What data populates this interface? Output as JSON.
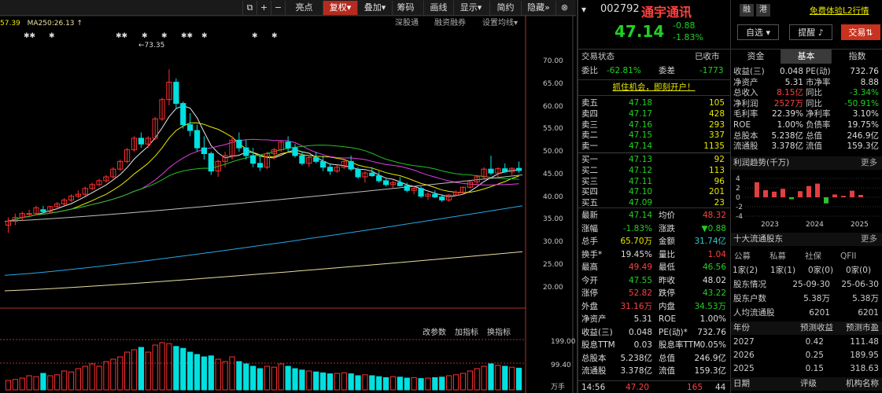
{
  "toolbar": {
    "items": [
      "亮点",
      "复权",
      "叠加",
      "筹码",
      "画线",
      "显示",
      "简约",
      "隐藏"
    ],
    "icons": [
      "layout-icon",
      "plus-icon",
      "minus-icon",
      "more-icon",
      "collapse-icon"
    ],
    "active": "复权"
  },
  "chart": {
    "ma_text1": "57.39",
    "ma_label2": "MA250:26.13",
    "ma_arrow": "↑",
    "stars": [
      "✱✱",
      "✱",
      "✱✱",
      "✱",
      "✱",
      "✱✱",
      "✱",
      "✱",
      "✱"
    ],
    "right_tools": [
      "深股通",
      "融资融券",
      "设置均线"
    ],
    "peak_label": "73.35",
    "y_ticks": [
      "70.00",
      "65.00",
      "60.00",
      "55.00",
      "50.00",
      "45.00",
      "40.00",
      "35.00",
      "30.00",
      "25.00",
      "20.00"
    ],
    "vol_tools": [
      "改参数",
      "加指标",
      "换指标"
    ],
    "vol_ticks": [
      "199.00",
      "99.40",
      "万手"
    ]
  },
  "chart_data": {
    "type": "candlestick",
    "ylim": [
      16,
      75
    ],
    "peak": 73.35,
    "last": 47.14,
    "ma250_last": 26.13,
    "ohlc": [
      [
        33,
        35,
        31,
        34
      ],
      [
        34,
        36,
        33,
        35
      ],
      [
        35,
        36.5,
        34,
        36
      ],
      [
        36,
        37,
        35,
        36
      ],
      [
        36,
        38,
        35.5,
        37.5
      ],
      [
        37,
        38,
        36,
        36.5
      ],
      [
        36.5,
        38,
        36,
        37.8
      ],
      [
        37.8,
        39,
        37,
        38.5
      ],
      [
        38.5,
        40,
        38,
        39.5
      ],
      [
        39.5,
        41,
        39,
        40.5
      ],
      [
        40.5,
        42,
        40,
        41
      ],
      [
        41,
        43,
        40.5,
        42.5
      ],
      [
        42.5,
        44,
        42,
        43.5
      ],
      [
        43.5,
        45,
        43,
        44.5
      ],
      [
        44.5,
        46,
        44,
        45.5
      ],
      [
        45.5,
        48,
        45,
        47.5
      ],
      [
        47.5,
        50,
        47,
        49.5
      ],
      [
        49.5,
        53,
        49,
        52.5
      ],
      [
        52.5,
        56,
        52,
        55.5
      ],
      [
        55.5,
        57,
        53,
        54
      ],
      [
        54,
        56,
        53,
        55.5
      ],
      [
        55.5,
        61,
        55,
        60.5
      ],
      [
        60.5,
        66,
        60,
        65.5
      ],
      [
        65.5,
        73.35,
        64,
        70
      ],
      [
        70,
        71,
        63,
        64.5
      ],
      [
        64.5,
        65,
        58,
        59
      ],
      [
        59,
        62,
        56,
        57.5
      ],
      [
        57.5,
        59,
        52,
        53
      ],
      [
        53,
        56,
        50,
        51.5
      ],
      [
        51.5,
        52,
        46,
        47
      ],
      [
        47,
        50,
        45.5,
        49.5
      ],
      [
        49.5,
        52,
        48,
        51
      ],
      [
        51,
        56,
        50,
        55
      ],
      [
        55,
        57,
        52,
        53
      ],
      [
        53,
        55,
        50,
        51
      ],
      [
        51,
        53,
        48,
        49
      ],
      [
        49,
        51,
        47,
        48
      ],
      [
        48,
        52,
        47.5,
        51.5
      ],
      [
        51.5,
        53,
        50,
        52.5
      ],
      [
        52.5,
        55,
        52,
        54.5
      ],
      [
        54.5,
        56,
        52,
        53
      ],
      [
        53,
        54,
        50.5,
        51
      ],
      [
        51,
        52,
        48.5,
        49
      ],
      [
        49,
        51,
        48,
        50.5
      ],
      [
        50.5,
        52,
        49,
        49.5
      ],
      [
        49.5,
        51,
        47,
        48
      ],
      [
        48,
        49,
        46,
        47
      ],
      [
        47,
        48.5,
        46.5,
        48
      ],
      [
        48,
        50,
        47.5,
        49.5
      ],
      [
        49.5,
        51,
        47,
        47.5
      ],
      [
        47.5,
        48,
        45,
        45.5
      ],
      [
        45.5,
        47,
        44,
        46.5
      ],
      [
        46.5,
        48,
        45.5,
        45.8
      ],
      [
        45.8,
        47,
        44,
        44.5
      ],
      [
        44.5,
        45,
        43,
        43.5
      ],
      [
        43.5,
        44.5,
        42.5,
        44
      ],
      [
        44,
        45.5,
        43,
        43.2
      ],
      [
        43.2,
        44,
        41.5,
        42
      ],
      [
        42,
        43,
        41,
        42.5
      ],
      [
        42.5,
        43,
        40,
        40.5
      ],
      [
        40.5,
        41.5,
        39.5,
        41
      ],
      [
        41,
        42,
        40,
        40.3
      ],
      [
        40.3,
        41,
        39,
        39.5
      ],
      [
        39.5,
        41,
        39,
        40.8
      ],
      [
        40.8,
        42,
        40.5,
        41.5
      ],
      [
        41.5,
        43,
        41,
        42.8
      ],
      [
        42.8,
        44.5,
        42.5,
        44.2
      ],
      [
        44.2,
        46,
        43.5,
        45.5
      ],
      [
        45.5,
        48,
        45,
        47.5
      ],
      [
        47.5,
        51,
        46,
        46.5
      ],
      [
        46.5,
        48,
        45,
        47.6
      ],
      [
        47.6,
        49,
        46.5,
        46.8
      ],
      [
        46.8,
        48,
        46,
        47.7
      ],
      [
        47.7,
        49.49,
        46.56,
        47.14
      ]
    ],
    "vol": [
      0.2,
      0.22,
      0.25,
      0.3,
      0.28,
      0.35,
      0.3,
      0.32,
      0.4,
      0.38,
      0.45,
      0.5,
      0.55,
      0.5,
      0.6,
      0.65,
      0.7,
      0.8,
      0.85,
      0.9,
      0.8,
      0.95,
      1.0,
      0.98,
      0.92,
      0.88,
      0.8,
      0.75,
      0.7,
      0.72,
      0.65,
      0.6,
      0.7,
      0.6,
      0.55,
      0.5,
      0.45,
      0.5,
      0.48,
      0.55,
      0.5,
      0.45,
      0.42,
      0.4,
      0.38,
      0.36,
      0.34,
      0.35,
      0.36,
      0.34,
      0.3,
      0.32,
      0.3,
      0.28,
      0.26,
      0.28,
      0.27,
      0.25,
      0.26,
      0.24,
      0.25,
      0.26,
      0.27,
      0.3,
      0.32,
      0.35,
      0.4,
      0.45,
      0.5,
      0.55,
      0.52,
      0.5,
      0.48,
      0.46
    ],
    "colors": {
      "up": "#ff3030",
      "down": "#00e0e0",
      "ma5": "#e8e8e8",
      "ma10": "#e8e800",
      "ma20": "#e040e0",
      "ma30": "#22c022",
      "ma60": "#c0c0c0",
      "ma120": "#28a8e8",
      "ma250": "#e8e0a0"
    }
  },
  "quote": {
    "code": "002792",
    "name": "通宇通讯",
    "badges": [
      "融",
      "港"
    ],
    "price": "47.14",
    "change": "-0.88",
    "pct": "-1.83%",
    "select_btn": "自选",
    "remind_btn": "提醒",
    "trade_btn": "交易",
    "promo": "免费体验L2行情",
    "status_label": "交易状态",
    "status": "已收市",
    "wb_label": "委比",
    "wb": "-62.81%",
    "wc_label": "委差",
    "wc": "-1773",
    "ad": "抓住机会，即刻开户！",
    "asks": [
      [
        "卖五",
        "47.18",
        "105"
      ],
      [
        "卖四",
        "47.17",
        "428"
      ],
      [
        "卖三",
        "47.16",
        "293"
      ],
      [
        "卖二",
        "47.15",
        "337"
      ],
      [
        "卖一",
        "47.14",
        "1135"
      ]
    ],
    "bids": [
      [
        "买一",
        "47.13",
        "92"
      ],
      [
        "买二",
        "47.12",
        "113"
      ],
      [
        "买三",
        "47.11",
        "96"
      ],
      [
        "买四",
        "47.10",
        "201"
      ],
      [
        "买五",
        "47.09",
        "23"
      ]
    ],
    "stats": [
      [
        "最新",
        "47.14",
        "均价",
        "48.32"
      ],
      [
        "涨幅",
        "-1.83%",
        "涨跌",
        "▼0.88"
      ],
      [
        "总手",
        "65.70万",
        "金额",
        "31.74亿"
      ],
      [
        "换手*",
        "19.45%",
        "量比",
        "1.04"
      ],
      [
        "最高",
        "49.49",
        "最低",
        "46.56"
      ],
      [
        "今开",
        "47.55",
        "昨收",
        "48.02"
      ],
      [
        "涨停",
        "52.82",
        "跌停",
        "43.22"
      ],
      [
        "外盘",
        "31.16万",
        "内盘",
        "34.53万"
      ],
      [
        "净资产",
        "5.31",
        "ROE",
        "1.00%"
      ],
      [
        "收益(三)",
        "0.048",
        "PE(动)*",
        "732.76"
      ],
      [
        "股息TTM",
        "0.03",
        "股息率TTM",
        "0.05%"
      ],
      [
        "总股本",
        "5.238亿",
        "总值",
        "246.9亿"
      ],
      [
        "流通股",
        "3.378亿",
        "流值",
        "159.3亿"
      ]
    ],
    "tick": {
      "time": "14:56",
      "price": "47.20",
      "vol": "165",
      "n": "44"
    }
  },
  "fund": {
    "tabs": [
      "资金",
      "基本",
      "指数"
    ],
    "active": "基本",
    "rows": [
      [
        "收益(三)",
        "0.048",
        "PE(动)",
        "732.76"
      ],
      [
        "净资产",
        "5.31",
        "市净率",
        "8.88"
      ],
      [
        "总收入",
        "8.15亿",
        "同比",
        "-3.34%"
      ],
      [
        "净利润",
        "2527万",
        "同比",
        "-50.91%"
      ],
      [
        "毛利率",
        "22.39%",
        "净利率",
        "3.10%"
      ],
      [
        "ROE",
        "1.00%",
        "负债率",
        "19.75%"
      ],
      [
        "总股本",
        "5.238亿",
        "总值",
        "246.9亿"
      ],
      [
        "流通股",
        "3.378亿",
        "流值",
        "159.3亿"
      ]
    ],
    "profit_title": "利润趋势(千万)",
    "more": "更多",
    "profit_ticks": [
      "4",
      "2",
      "0",
      "-2",
      "-4"
    ],
    "profit_years": [
      "2023",
      "2024",
      "2025"
    ],
    "profit_bars": [
      3.2,
      1.5,
      1.2,
      1.8,
      -0.4,
      1.3,
      2.4,
      2.9,
      -1.3,
      0.6,
      0.3,
      1.4,
      0.5
    ],
    "holders_title": "十大流通股东",
    "holder_heads": [
      "公募",
      "私募",
      "社保",
      "QFII"
    ],
    "holder_vals": [
      "1家(2)",
      "1家(1)",
      "0家(0)",
      "0家(0)"
    ],
    "hold_rows": [
      [
        "股东情况",
        "25-09-30",
        "25-06-30"
      ],
      [
        "股东户数",
        "5.38万",
        "5.38万"
      ],
      [
        "人均流通股",
        "6201",
        "6201"
      ]
    ],
    "fc_heads": [
      "年份",
      "预测收益",
      "预测市盈"
    ],
    "fc_rows": [
      [
        "2027",
        "0.42",
        "111.48"
      ],
      [
        "2026",
        "0.25",
        "189.95"
      ],
      [
        "2025",
        "0.15",
        "318.63"
      ]
    ],
    "inst_heads": [
      "日期",
      "评级",
      "机构名称"
    ]
  }
}
